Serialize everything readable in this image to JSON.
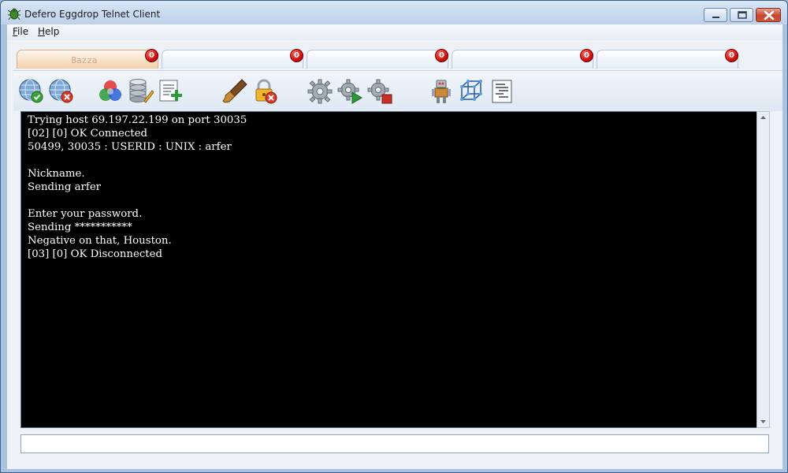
{
  "window": {
    "title": "Defero Eggdrop Telnet Client",
    "buttons": {
      "minimize": "minimize",
      "maximize": "maximize",
      "close": "close"
    }
  },
  "menu": {
    "items": [
      {
        "label": "File",
        "accel": "F",
        "rest": "ile"
      },
      {
        "label": "Help",
        "accel": "H",
        "rest": "elp"
      }
    ]
  },
  "tabs": [
    {
      "label": "Bazza",
      "badge": "0",
      "active": true
    },
    {
      "label": "",
      "badge": "0",
      "active": false
    },
    {
      "label": "",
      "badge": "0",
      "active": false
    },
    {
      "label": "",
      "badge": "0",
      "active": false
    },
    {
      "label": "",
      "badge": "0",
      "active": false
    }
  ],
  "toolbar": {
    "icons": [
      "connect-globe-icon",
      "disconnect-globe-icon",
      "color-circles-icon",
      "database-edit-icon",
      "add-list-icon",
      "brush-icon",
      "lock-remove-icon",
      "settings-gear-icon",
      "gear-play-icon",
      "gear-stop-icon",
      "robot-icon",
      "cube-icon",
      "text-document-icon"
    ]
  },
  "console": {
    "lines": [
      "Trying host 69.197.22.199 on port 30035",
      "[02] [0] OK Connected",
      "50499, 30035 : USERID : UNIX : arfer",
      "",
      "Nickname.",
      "Sending arfer",
      "",
      "Enter your password.",
      "Sending ***********",
      "Negative on that, Houston.",
      "[03] [0] OK Disconnected"
    ]
  },
  "input": {
    "value": "",
    "placeholder": ""
  },
  "colors": {
    "console_background": "#000000",
    "console_text": "#ffffff",
    "badge": "#d10f0f",
    "active_tab": "#f3d1a7"
  }
}
